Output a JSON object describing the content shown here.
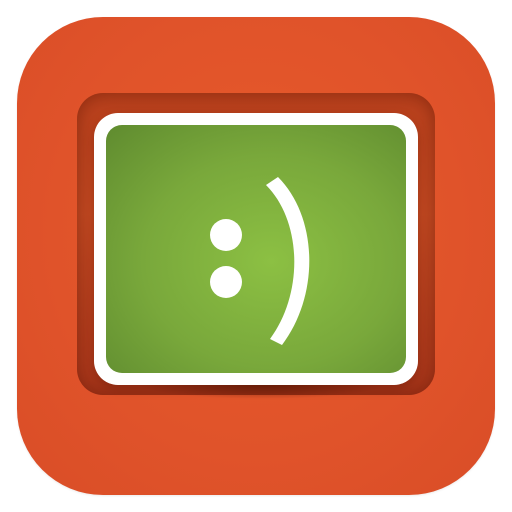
{
  "icon": {
    "name": "smiley-tv-app-icon",
    "face_glyph": ":)"
  },
  "colors": {
    "tile": "#e0532a",
    "recess": "#b8401c",
    "bezel": "#ffffff",
    "display": "#7fb23f",
    "face": "#ffffff"
  }
}
